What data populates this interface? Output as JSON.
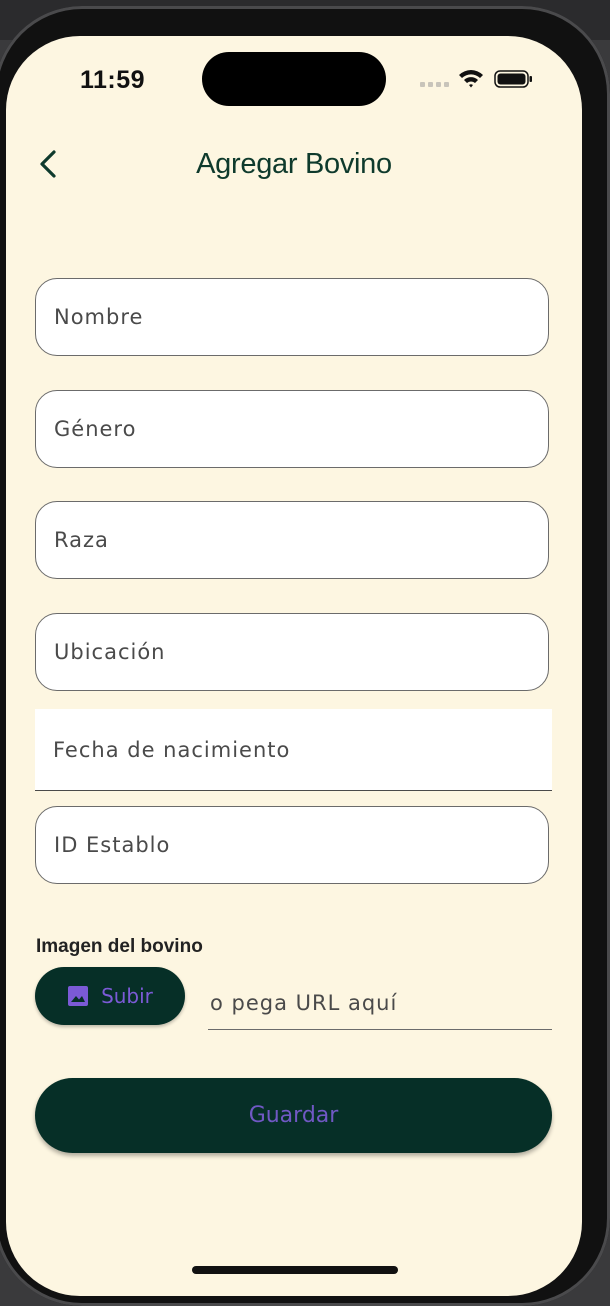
{
  "status_bar": {
    "time": "11:59"
  },
  "header": {
    "title": "Agregar Bovino"
  },
  "form": {
    "fields": [
      {
        "label": "Nombre"
      },
      {
        "label": "Género"
      },
      {
        "label": "Raza"
      },
      {
        "label": "Ubicación"
      },
      {
        "label": "Fecha de nacimiento"
      },
      {
        "label": "ID Establo"
      }
    ],
    "image_section": {
      "label": "Imagen del bovino",
      "upload_label": "Subir",
      "url_placeholder": "o pega URL aquí"
    },
    "save_label": "Guardar"
  },
  "colors": {
    "background": "#fdf6e1",
    "primary": "#062f27",
    "button_text": "#7058c4",
    "title": "#0e3a2c"
  },
  "icons": {
    "back": "chevron-left-icon",
    "upload": "image-icon",
    "wifi": "wifi-icon",
    "battery": "battery-icon"
  }
}
